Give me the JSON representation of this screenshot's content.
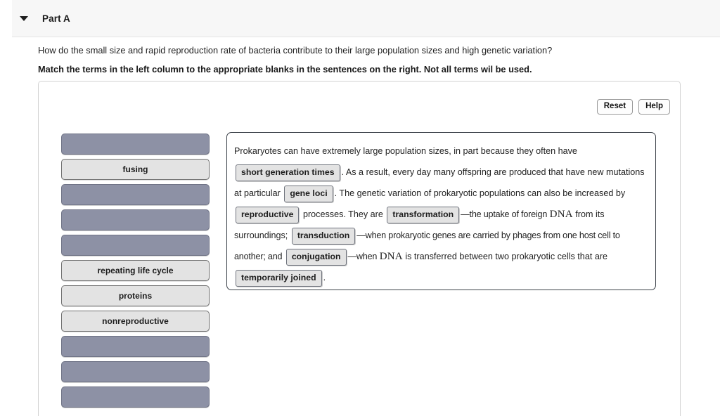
{
  "header": {
    "caret_icon": "chevron-down-icon",
    "title": "Part A"
  },
  "question": {
    "prompt": "How do the small size and rapid reproduction rate of bacteria contribute to their large population sizes and high genetic variation?",
    "instruction": "Match the terms in the left column to the appropriate blanks in the sentences on the right. Not all terms wil be used."
  },
  "toolbar": {
    "reset_label": "Reset",
    "help_label": "Help"
  },
  "term_column": {
    "items": [
      {
        "label": "",
        "state": "filled"
      },
      {
        "label": "fusing",
        "state": "available"
      },
      {
        "label": "",
        "state": "filled"
      },
      {
        "label": "",
        "state": "filled"
      },
      {
        "label": "",
        "state": "filled"
      },
      {
        "label": "repeating life cycle",
        "state": "available"
      },
      {
        "label": "proteins",
        "state": "available"
      },
      {
        "label": "nonreproductive",
        "state": "available"
      },
      {
        "label": "",
        "state": "filled"
      },
      {
        "label": "",
        "state": "filled"
      },
      {
        "label": "",
        "state": "filled"
      }
    ]
  },
  "sentence": {
    "t1": "Prokaryotes can have extremely large population sizes, in part because they often have",
    "blank1": "short generation times",
    "t2": ". As a result, every day many offspring are produced that have new mutations at particular",
    "blank2": "gene loci",
    "t3": ". The genetic variation of prokaryotic populations can also be increased by",
    "blank3": "reproductive",
    "t4": "processes. They are",
    "blank4": "transformation",
    "t5": "—the uptake of foreign",
    "dna1": "DNA",
    "t6": "from its surroundings;",
    "blank5": "transduction",
    "t7": "—when prokaryotic genes are carried by phages from one host cell to another; and",
    "blank6": "conjugation",
    "t8": "—when",
    "dna2": "DNA",
    "t9": "is transferred between two prokaryotic cells that are",
    "blank7": "temporarily joined",
    "t10": "."
  }
}
